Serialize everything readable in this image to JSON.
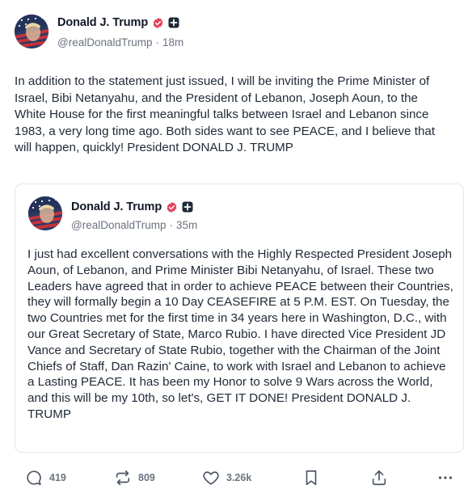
{
  "post": {
    "author": {
      "name": "Donald J. Trump",
      "handle": "@realDonaldTrump",
      "separator": "·",
      "time": "18m"
    },
    "text": "In addition to the statement just issued, I will be inviting the Prime Minister of Israel, Bibi Netanyahu, and the President of Lebanon, Joseph Aoun, to the White House for the first meaningful talks between Israel and Lebanon since 1983, a very long time ago. Both sides want to see PEACE, and I believe that will happen, quickly! President DONALD J. TRUMP"
  },
  "quoted_post": {
    "author": {
      "name": "Donald J. Trump",
      "handle": "@realDonaldTrump",
      "separator": "·",
      "time": "35m"
    },
    "text": "I just had excellent conversations with the Highly Respected President Joseph Aoun, of Lebanon, and Prime Minister Bibi Netanyahu, of Israel. These two Leaders have agreed that in order to achieve PEACE between their Countries, they will formally begin a 10 Day CEASEFIRE at 5 P.M. EST. On Tuesday, the two Countries met for the first time in 34 years here in Washington, D.C., with our Great Secretary of State, Marco Rubio. I have directed Vice President JD Vance and Secretary of State Rubio, together with the Chairman of the Joint Chiefs of Staff, Dan Razin' Caine, to work with Israel and Lebanon to achieve a Lasting PEACE. It has been my Honor to solve 9 Wars across the World, and this will be my 10th, so let's, GET IT DONE! President DONALD J. TRUMP"
  },
  "actions": {
    "replies": "419",
    "retruths": "809",
    "likes": "3.26k"
  },
  "icons": {
    "verified": "verified-badge-icon",
    "plus": "plus-badge-icon",
    "reply": "reply-icon",
    "retruth": "retruth-icon",
    "like": "heart-icon",
    "bookmark": "bookmark-icon",
    "share": "share-icon",
    "more": "more-icon"
  },
  "colors": {
    "verified": "#e2445c",
    "text": "#1f2937",
    "muted": "#6b7280",
    "border": "#e5e7eb"
  }
}
